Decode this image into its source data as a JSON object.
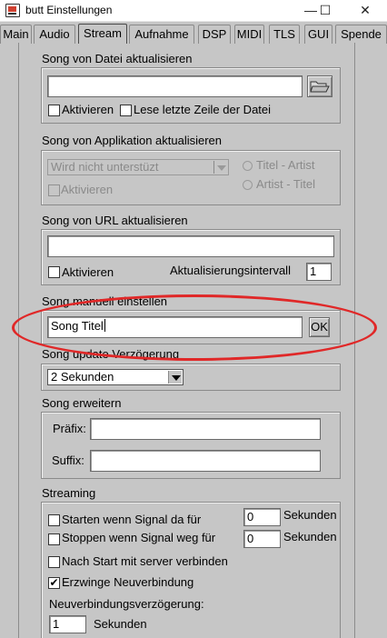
{
  "window": {
    "title": "butt Einstellungen",
    "minimize": "—",
    "maximize": "☐",
    "close": "✕"
  },
  "tabs": [
    "Main",
    "Audio",
    "Stream",
    "Aufnahme",
    "DSP",
    "MIDI",
    "TLS",
    "GUI",
    "Spende"
  ],
  "active_tab": "Stream",
  "file_song": {
    "title": "Song von Datei aktualisieren",
    "path_value": "",
    "activate_label": "Aktivieren",
    "last_line_label": "Lese letzte Zeile der Datei"
  },
  "app_song": {
    "title": "Song von Applikation aktualisieren",
    "app_select": "Wird nicht unterstüzt",
    "activate_label": "Aktivieren",
    "radio_title_artist": "Titel - Artist",
    "radio_artist_title": "Artist - Titel"
  },
  "url_song": {
    "title": "Song von URL aktualisieren",
    "url_value": "",
    "activate_label": "Aktivieren",
    "interval_label": "Aktualisierungsintervall",
    "interval_value": "1"
  },
  "manual_song": {
    "title": "Song manuell einstellen",
    "value": "Song Titel",
    "ok_label": "OK"
  },
  "song_delay": {
    "title": "Song update Verzögerung",
    "value": "2 Sekunden"
  },
  "song_extend": {
    "title": "Song erweitern",
    "prefix_label": "Präfix:",
    "prefix_value": "",
    "suffix_label": "Suffix:",
    "suffix_value": ""
  },
  "streaming": {
    "title": "Streaming",
    "start_signal_label": "Starten wenn Signal da für",
    "start_signal_value": "0",
    "start_signal_unit": "Sekunden",
    "stop_signal_label": "Stoppen wenn Signal weg für",
    "stop_signal_value": "0",
    "stop_signal_unit": "Sekunden",
    "connect_after_start_label": "Nach Start mit server verbinden",
    "force_reconnect_label": "Erzwinge Neuverbindung",
    "force_reconnect_checked": true,
    "reconnect_delay_label": "Neuverbindungsverzögerung:",
    "reconnect_delay_value": "1",
    "reconnect_delay_unit": "Sekunden"
  },
  "colors": {
    "annotation_ellipse": "#e02828",
    "background": "#c6c6c6"
  }
}
